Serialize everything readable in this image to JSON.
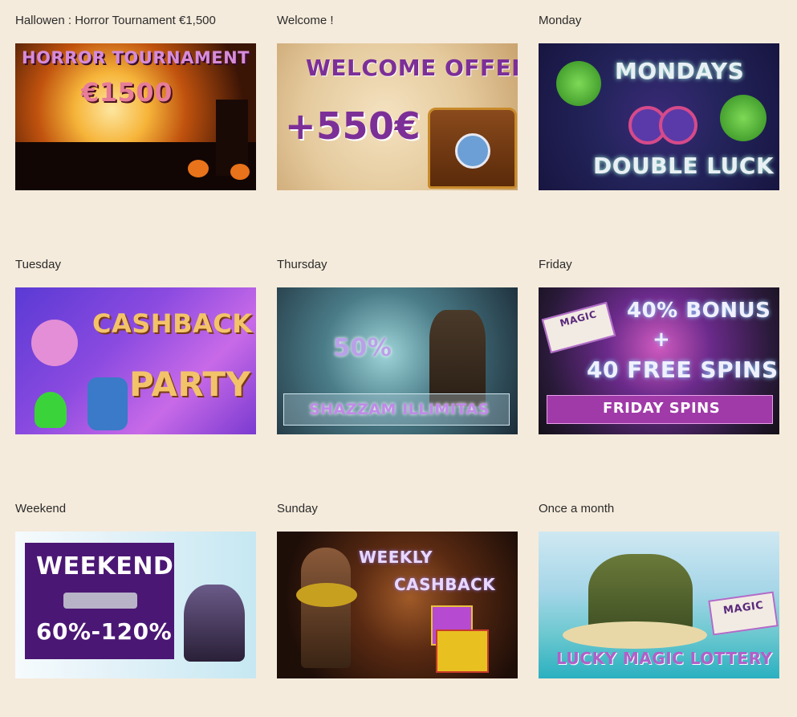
{
  "promotions": [
    {
      "label": "Hallowen : Horror Tournament €1,500",
      "banner_lines": [
        "HORROR TOURNAMENT",
        "€1500"
      ]
    },
    {
      "label": "Welcome !",
      "banner_lines": [
        "WELCOME OFFER",
        "+550€"
      ]
    },
    {
      "label": "Monday",
      "banner_lines": [
        "MONDAYS",
        "DOUBLE LUCK"
      ]
    },
    {
      "label": "Tuesday",
      "banner_lines": [
        "CASHBACK",
        "PARTY"
      ]
    },
    {
      "label": "Thursday",
      "banner_lines": [
        "SHAZZAM ILLIMITAS",
        "50%"
      ]
    },
    {
      "label": "Friday",
      "banner_lines": [
        "40% BONUS",
        "+",
        "40 FREE SPINS",
        "FRIDAY SPINS",
        "MAGIC"
      ]
    },
    {
      "label": "Weekend",
      "banner_lines": [
        "WEEKEND",
        "60%-120%"
      ]
    },
    {
      "label": "Sunday",
      "banner_lines": [
        "WEEKLY",
        "CASHBACK"
      ]
    },
    {
      "label": "Once a month",
      "banner_lines": [
        "LUCKY MAGIC LOTTERY",
        "MAGIC"
      ]
    }
  ],
  "colors": {
    "page_background": "#f5ebdc",
    "label_text": "#2b2b2b"
  }
}
